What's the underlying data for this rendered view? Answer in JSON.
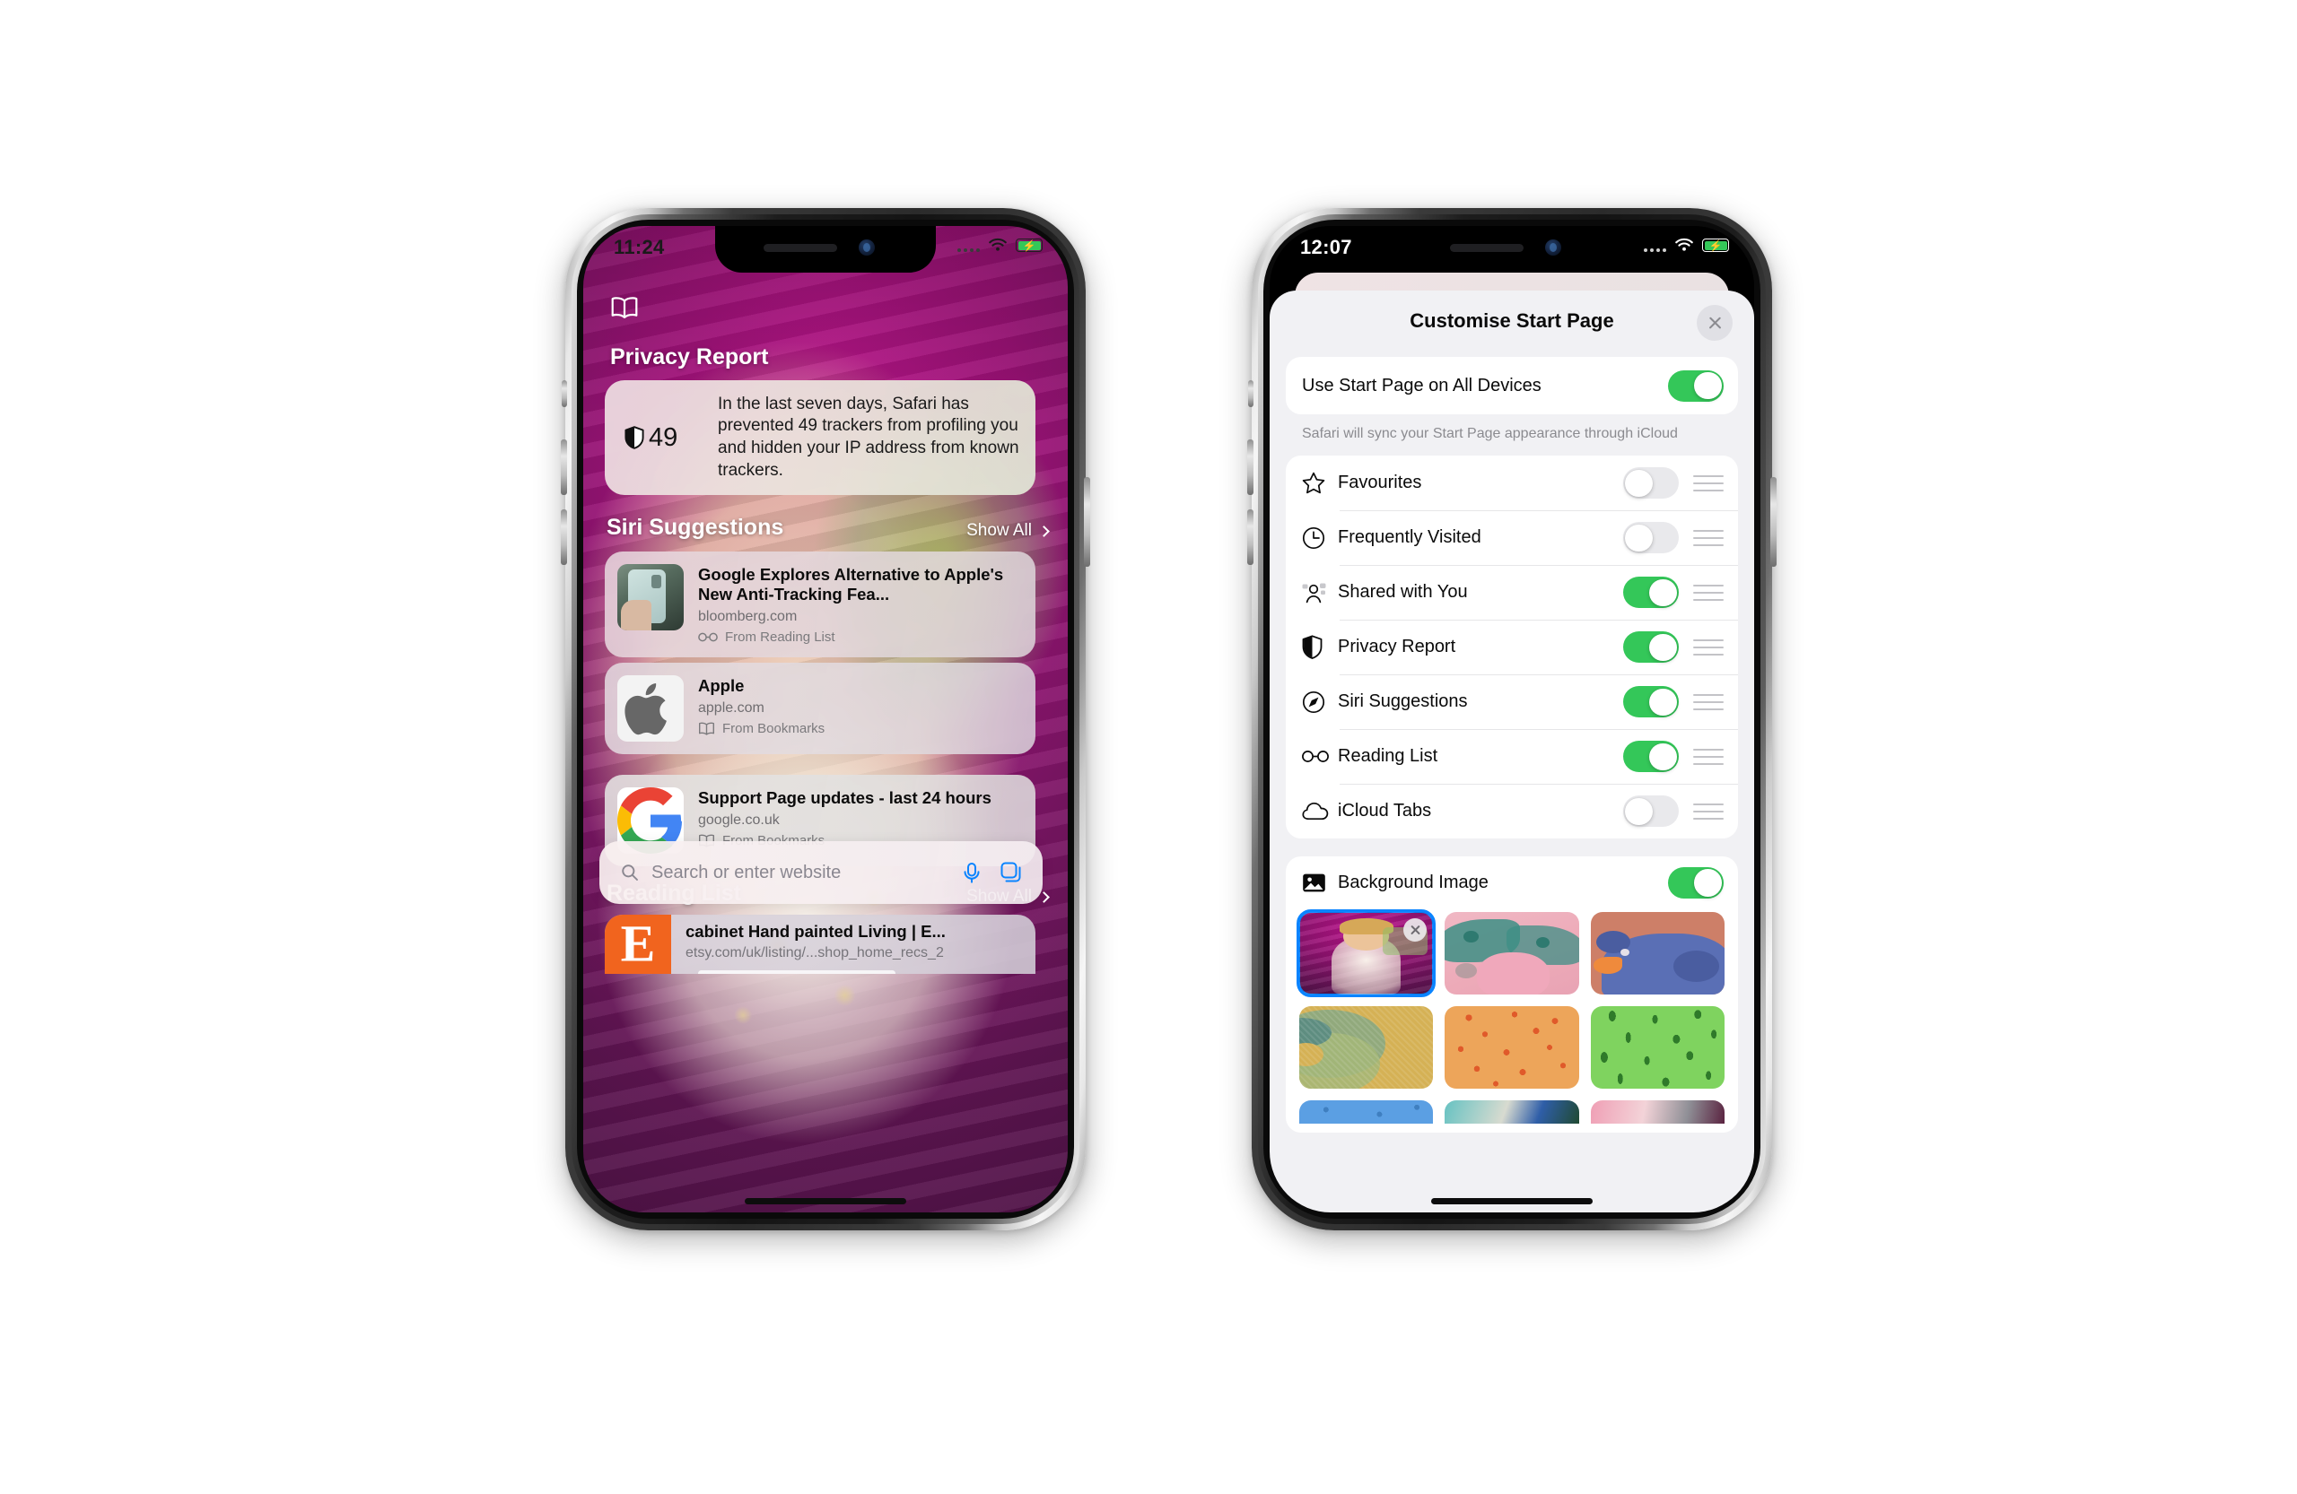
{
  "left_phone": {
    "status_bar": {
      "time": "11:24",
      "wifi": "wifi-icon",
      "battery": "battery-charging-icon"
    },
    "bookmarks_icon": "book-icon",
    "privacy": {
      "section_title": "Privacy Report",
      "tracker_count": "49",
      "shield_icon": "shield-icon",
      "description": "In the last seven days, Safari has prevented 49 trackers from profiling you and hidden your IP address from known trackers."
    },
    "siri": {
      "section_title": "Siri Suggestions",
      "show_all": "Show All",
      "chevron_icon": "chevron-right-icon",
      "items": [
        {
          "title": "Google Explores Alternative to Apple's New Anti-Tracking Fea...",
          "url": "bloomberg.com",
          "source": "From Reading List",
          "source_icon": "glasses-icon",
          "thumb": "phone-photo"
        },
        {
          "title": "Apple",
          "url": "apple.com",
          "source": "From Bookmarks",
          "source_icon": "book-icon",
          "thumb": "apple-logo"
        },
        {
          "title": "Support Page updates - last 24 hours",
          "url": "google.co.uk",
          "source": "From Bookmarks",
          "source_icon": "book-icon",
          "thumb": "google-logo"
        }
      ]
    },
    "reading_list": {
      "section_title": "Reading List",
      "show_all": "Show All",
      "items": [
        {
          "title": "cabinet Hand painted Living | E...",
          "url": "etsy.com/uk/listing/...shop_home_recs_2",
          "thumb": "etsy-logo",
          "thumb_letter": "E"
        }
      ]
    },
    "search_bar": {
      "placeholder": "Search or enter website",
      "search_icon": "search-icon",
      "mic_icon": "microphone-icon",
      "tabs_icon": "tabs-icon",
      "accent": "#0a84ff"
    }
  },
  "right_phone": {
    "status_bar": {
      "time": "12:07",
      "wifi": "wifi-icon",
      "battery": "battery-charging-icon"
    },
    "sheet": {
      "title": "Customise Start Page",
      "close_icon": "close-icon",
      "sync_row": {
        "label": "Use Start Page on All Devices",
        "enabled": true
      },
      "sync_note": "Safari will sync your Start Page appearance through iCloud",
      "sections": [
        {
          "label": "Favourites",
          "icon": "star-icon",
          "enabled": false,
          "drag": "drag-handle-icon"
        },
        {
          "label": "Frequently Visited",
          "icon": "clock-icon",
          "enabled": false,
          "drag": "drag-handle-icon"
        },
        {
          "label": "Shared with You",
          "icon": "shared-with-you-icon",
          "enabled": true,
          "drag": "drag-handle-icon"
        },
        {
          "label": "Privacy Report",
          "icon": "shield-icon",
          "enabled": true,
          "drag": "drag-handle-icon"
        },
        {
          "label": "Siri Suggestions",
          "icon": "compass-icon",
          "enabled": true,
          "drag": "drag-handle-icon"
        },
        {
          "label": "Reading List",
          "icon": "glasses-icon",
          "enabled": true,
          "drag": "drag-handle-icon"
        },
        {
          "label": "iCloud Tabs",
          "icon": "cloud-icon",
          "enabled": false,
          "drag": "drag-handle-icon"
        }
      ],
      "background_image": {
        "label": "Background Image",
        "icon": "photo-icon",
        "enabled": true,
        "thumbnails": [
          {
            "name": "custom-photo-toddler",
            "selected": true,
            "removable": true,
            "remove_icon": "remove-icon"
          },
          {
            "name": "butterfly-pink",
            "selected": false,
            "removable": false
          },
          {
            "name": "bear-terracotta",
            "selected": false,
            "removable": false
          },
          {
            "name": "abstract-olive",
            "selected": false,
            "removable": false
          },
          {
            "name": "dots-orange",
            "selected": false,
            "removable": false
          },
          {
            "name": "leaves-green",
            "selected": false,
            "removable": false
          },
          {
            "name": "pattern-blue",
            "selected": false,
            "removable": false
          },
          {
            "name": "stripes-teal",
            "selected": false,
            "removable": false
          },
          {
            "name": "folds-pink",
            "selected": false,
            "removable": false
          }
        ]
      }
    },
    "colors": {
      "toggle_on": "#34c759",
      "toggle_off": "#e9e9ec",
      "selection": "#0a84ff"
    }
  }
}
